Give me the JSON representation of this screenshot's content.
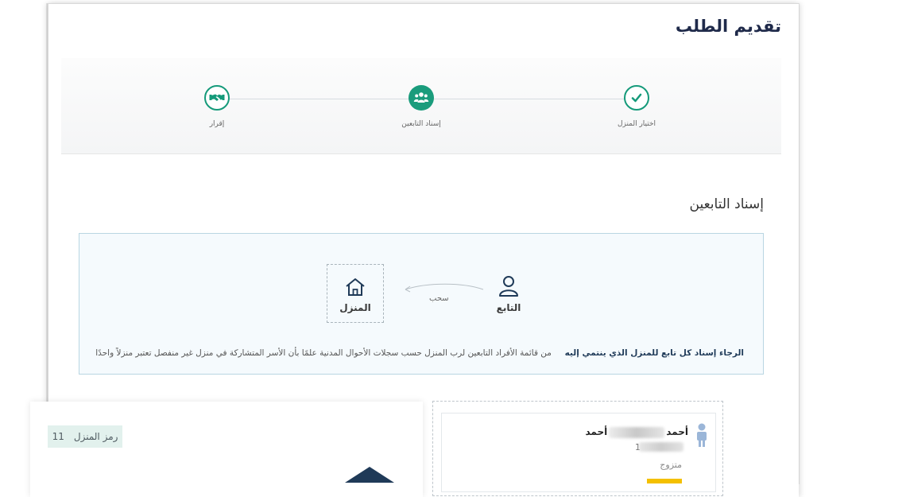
{
  "page": {
    "title": "تقديم الطلب"
  },
  "stepper": {
    "steps": [
      {
        "label": "اختيار المنزل",
        "icon": "check-icon",
        "state": "completed"
      },
      {
        "label": "إسناد التابعين",
        "icon": "users-icon",
        "state": "active"
      },
      {
        "label": "إقرار",
        "icon": "handshake-icon",
        "state": "pending"
      }
    ]
  },
  "section": {
    "title": "إسناد التابعين"
  },
  "instructions": {
    "member_label": "التابع",
    "drag_label": "سحب",
    "house_label": "المنزل",
    "bold_text": "الرجاء إسناد كل تابع للمنزل الذي ينتمي إليه",
    "body_text": "من قائمة الأفراد التابعين لرب المنزل حسب سجلات الأحوال المدنية علمًا بأن الأسر المتشاركة في منزل غير منفصل تعتبر منزلاً واحدًا"
  },
  "house_card": {
    "code_label": "رمز المنزل",
    "code_value": "11",
    "icon": "house-roof-icon"
  },
  "member_card": {
    "name_first": "أحمد",
    "name_last": "أحمد",
    "id_prefix": "1",
    "status": "متزوج",
    "icon": "person-icon",
    "badge_color": "#f4c000"
  },
  "colors": {
    "accent": "#1a9c7c",
    "title": "#1f2a4a",
    "info_bg": "#f5fafd",
    "info_border": "#b9d6e2"
  }
}
